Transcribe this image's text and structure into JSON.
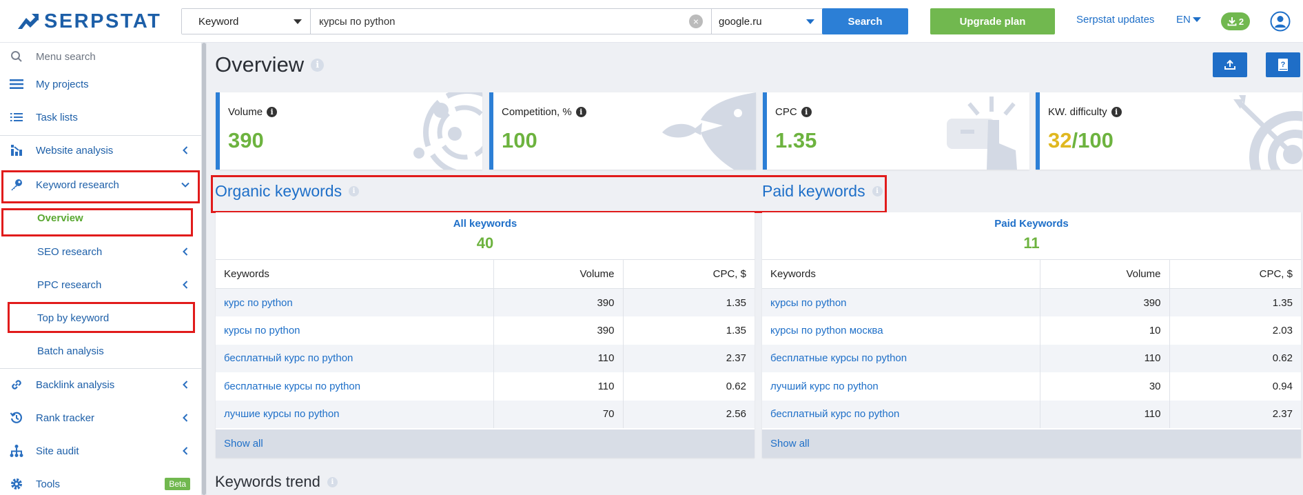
{
  "header": {
    "logo_text": "SERPSTAT",
    "search_type": "Keyword",
    "search_query": "курсы по python",
    "search_db": "google.ru",
    "search_button": "Search",
    "upgrade_button": "Upgrade plan",
    "updates_link": "Serpstat updates",
    "language": "EN",
    "downloads_count": "2"
  },
  "sidebar": {
    "menu_search": "Menu search",
    "my_projects": "My projects",
    "task_lists": "Task lists",
    "website_analysis": "Website analysis",
    "keyword_research": "Keyword research",
    "overview": "Overview",
    "seo_research": "SEO research",
    "ppc_research": "PPC research",
    "top_by_keyword": "Top by keyword",
    "batch_analysis": "Batch analysis",
    "backlink_analysis": "Backlink analysis",
    "rank_tracker": "Rank tracker",
    "site_audit": "Site audit",
    "tools": "Tools",
    "tools_badge": "Beta"
  },
  "main": {
    "title": "Overview",
    "metrics": [
      {
        "label": "Volume",
        "value": "390"
      },
      {
        "label": "Competition, %",
        "value": "100"
      },
      {
        "label": "CPC",
        "value": "1.35"
      },
      {
        "label": "KW. difficulty",
        "value_a": "32",
        "value_b": "/100"
      }
    ],
    "organic": {
      "title": "Organic keywords",
      "summary_label": "All keywords",
      "summary_value": "40",
      "columns": [
        "Keywords",
        "Volume",
        "CPC, $"
      ],
      "rows": [
        {
          "keyword": "курс по python",
          "volume": "390",
          "cpc": "1.35"
        },
        {
          "keyword": "курсы по python",
          "volume": "390",
          "cpc": "1.35"
        },
        {
          "keyword": "бесплатный курс по python",
          "volume": "110",
          "cpc": "2.37"
        },
        {
          "keyword": "бесплатные курсы по python",
          "volume": "110",
          "cpc": "0.62"
        },
        {
          "keyword": "лучшие курсы по python",
          "volume": "70",
          "cpc": "2.56"
        }
      ],
      "show_all": "Show all"
    },
    "paid": {
      "title": "Paid keywords",
      "summary_label": "Paid Keywords",
      "summary_value": "11",
      "columns": [
        "Keywords",
        "Volume",
        "CPC, $"
      ],
      "rows": [
        {
          "keyword": "курсы по python",
          "volume": "390",
          "cpc": "1.35"
        },
        {
          "keyword": "курсы по python москва",
          "volume": "10",
          "cpc": "2.03"
        },
        {
          "keyword": "бесплатные курсы по python",
          "volume": "110",
          "cpc": "0.62"
        },
        {
          "keyword": "лучший курс по python",
          "volume": "30",
          "cpc": "0.94"
        },
        {
          "keyword": "бесплатный курс по python",
          "volume": "110",
          "cpc": "2.37"
        }
      ],
      "show_all": "Show all"
    },
    "trend_title": "Keywords trend"
  }
}
